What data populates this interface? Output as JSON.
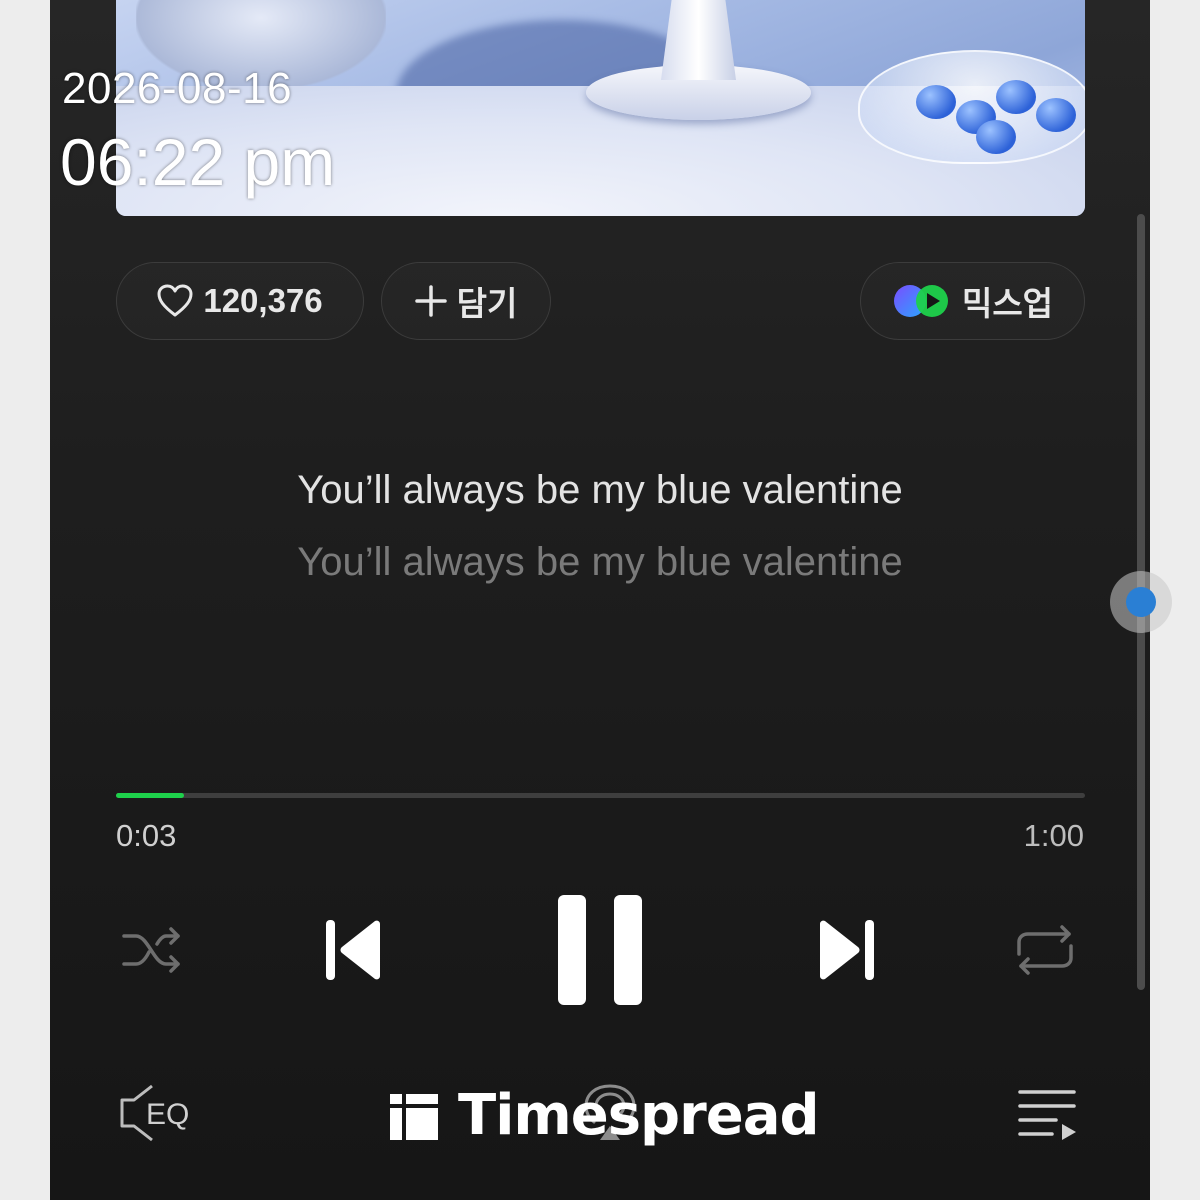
{
  "overlay": {
    "date": "2026-08-16",
    "time": "06:22 pm"
  },
  "actions": {
    "like_count": "120,376",
    "add_label": "담기",
    "mixup_label": "믹스업"
  },
  "lyrics": {
    "current": "You’ll always be my blue valentine",
    "next": "You’ll always be my blue valentine"
  },
  "playback": {
    "elapsed": "0:03",
    "total": "1:00",
    "progress_fraction": 0.07,
    "state": "playing"
  },
  "bottom_bar": {
    "eq_label": "EQ",
    "watermark": "Timespread"
  },
  "colors": {
    "accent_green": "#1ed14b",
    "background": "#1e1e1e",
    "scroll_knob": "#2a7fd4"
  },
  "icons": [
    "heart-icon",
    "plus-icon",
    "mixup-icon",
    "shuffle-icon",
    "previous-icon",
    "pause-icon",
    "next-icon",
    "repeat-icon",
    "eq-icon",
    "cast-icon",
    "playlist-icon",
    "watermark-logo-icon"
  ]
}
